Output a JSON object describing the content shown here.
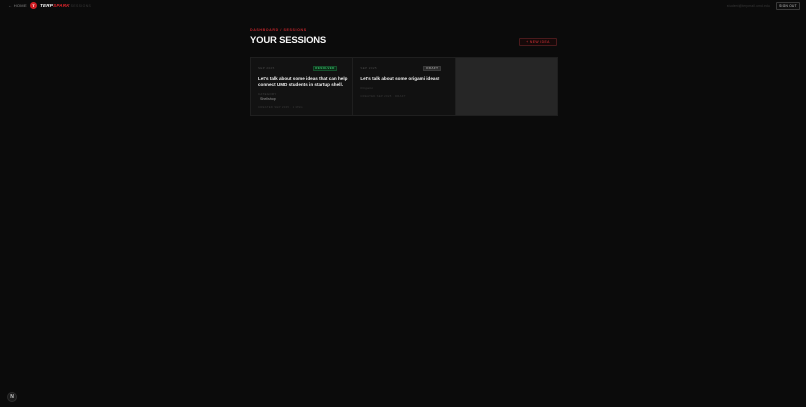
{
  "topbar": {
    "home_label": "← HOME",
    "logo_letter": "T",
    "brand_part1": "TERP",
    "brand_part2": "SPARK",
    "brand_sub": "/ SESSIONS",
    "user_email": "student@terpmail.umd.edu",
    "signout_label": "SIGN OUT"
  },
  "header": {
    "breadcrumb": "DASHBOARD / SESSIONS",
    "title": "YOUR SESSIONS",
    "new_idea_label": "+ NEW IDEA"
  },
  "sessions": [
    {
      "date": "SEP 2025",
      "status": "RESOLVED",
      "title": "Let's talk about some ideas that can help connect UMD students in startup shell.",
      "category_label": "CATEGORY",
      "category": "Shellshop",
      "meta": "CREATED SEP 2025 · 1 MSG"
    },
    {
      "date": "SEP 2025",
      "status": "DRAFT",
      "title": "Let's talk about some origami ideas!",
      "category_label": "Origami",
      "meta": "CREATED SEP 2025 · DRAFT"
    }
  ],
  "help": {
    "icon": "N"
  }
}
